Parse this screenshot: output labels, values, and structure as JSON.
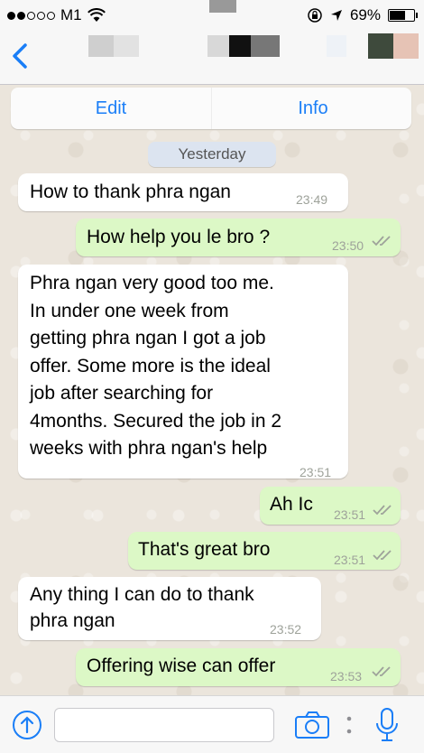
{
  "status_bar": {
    "carrier": "M1",
    "battery": "69%",
    "battery_level": 0.69
  },
  "nav": {
    "back_icon": "chevron-left-icon"
  },
  "actions": {
    "edit": "Edit",
    "info": "Info"
  },
  "date_separator": "Yesterday",
  "messages": [
    {
      "direction": "in",
      "text": "How to thank phra ngan",
      "time": "23:49"
    },
    {
      "direction": "out",
      "text": "How help you le bro ?",
      "time": "23:50",
      "status": "read"
    },
    {
      "direction": "in",
      "lines": [
        "Phra ngan very good too me.",
        "In under one week from",
        "getting phra ngan I got a job",
        "offer. Some more is the ideal",
        "job after searching for",
        "4months. Secured the job in 2",
        "weeks with phra ngan's help"
      ],
      "time": "23:51"
    },
    {
      "direction": "out",
      "text": "Ah Ic",
      "time": "23:51",
      "status": "read"
    },
    {
      "direction": "out",
      "text": "That's great bro",
      "time": "23:51",
      "status": "read"
    },
    {
      "direction": "in",
      "lines": [
        "Any thing I can do to thank",
        "phra ngan"
      ],
      "time": "23:52"
    },
    {
      "direction": "out",
      "text": "Offering wise can offer",
      "time": "23:53",
      "status": "read"
    }
  ],
  "input": {
    "placeholder": "",
    "icons": [
      "upload-icon",
      "camera-icon",
      "more-dots-icon",
      "microphone-icon"
    ]
  },
  "colors": {
    "accent": "#1a7ef7",
    "incoming": "#ffffff",
    "outgoing": "#dcf8c6",
    "background": "#ece5dd"
  }
}
